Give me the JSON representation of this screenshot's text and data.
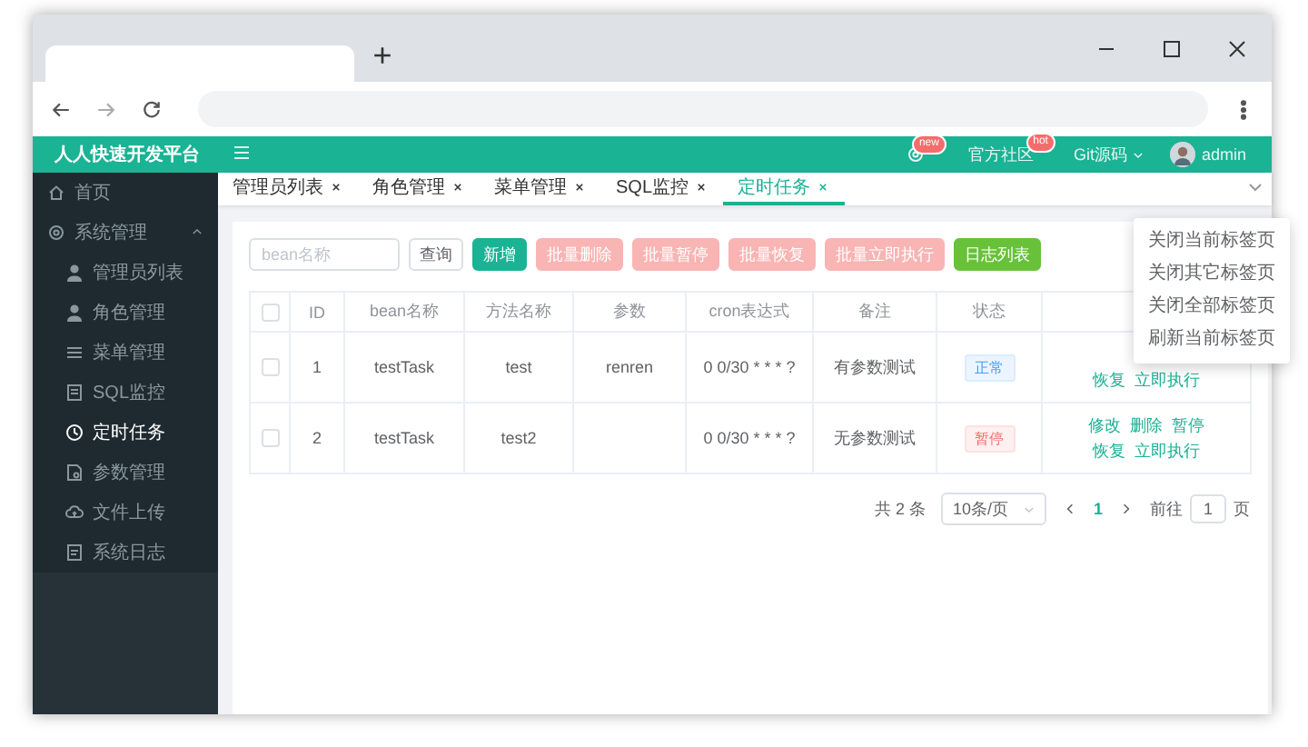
{
  "app": {
    "title": "人人快速开发平台"
  },
  "header": {
    "links": [
      {
        "kind": "icon",
        "badge": "new"
      },
      {
        "kind": "text",
        "label": "官方社区",
        "badge": "hot"
      },
      {
        "kind": "dropdown",
        "label": "Git源码"
      },
      {
        "kind": "user",
        "label": "admin"
      }
    ]
  },
  "sidebar": {
    "items": [
      {
        "label": "首页",
        "selected": false
      },
      {
        "label": "系统管理",
        "selected": false,
        "expanded": true,
        "children": [
          {
            "label": "管理员列表",
            "selected": false
          },
          {
            "label": "角色管理",
            "selected": false
          },
          {
            "label": "菜单管理",
            "selected": false
          },
          {
            "label": "SQL监控",
            "selected": false
          },
          {
            "label": "定时任务",
            "selected": true
          },
          {
            "label": "参数管理",
            "selected": false
          },
          {
            "label": "文件上传",
            "selected": false
          },
          {
            "label": "系统日志",
            "selected": false
          }
        ]
      }
    ]
  },
  "tabs": [
    {
      "label": "管理员列表",
      "selected": false
    },
    {
      "label": "角色管理",
      "selected": false
    },
    {
      "label": "菜单管理",
      "selected": false
    },
    {
      "label": "SQL监控",
      "selected": false
    },
    {
      "label": "定时任务",
      "selected": true
    }
  ],
  "tab_menu": {
    "items": [
      "关闭当前标签页",
      "关闭其它标签页",
      "关闭全部标签页",
      "刷新当前标签页"
    ]
  },
  "toolbar": {
    "search": {
      "placeholder": "bean名称"
    },
    "buttons": [
      {
        "label": "查询",
        "kind": "default",
        "disabled": false
      },
      {
        "label": "新增",
        "kind": "primary",
        "disabled": false
      },
      {
        "label": "批量删除",
        "kind": "danger",
        "disabled": true
      },
      {
        "label": "批量暂停",
        "kind": "danger",
        "disabled": true
      },
      {
        "label": "批量恢复",
        "kind": "danger",
        "disabled": true
      },
      {
        "label": "批量立即执行",
        "kind": "danger",
        "disabled": true
      },
      {
        "label": "日志列表",
        "kind": "success",
        "disabled": false
      }
    ]
  },
  "table": {
    "all_selected": false,
    "columns": [
      "ID",
      "bean名称",
      "方法名称",
      "参数",
      "cron表达式",
      "备注",
      "状态"
    ],
    "rows": [
      {
        "selected": false,
        "id": "1",
        "bean": "testTask",
        "method": "test",
        "params": "renren",
        "cron": "0 0/30 * * * ?",
        "remark": "有参数测试",
        "status": {
          "label": "正常",
          "kind": "normal"
        },
        "actions_bottom": [
          "恢复",
          "立即执行"
        ]
      },
      {
        "selected": false,
        "id": "2",
        "bean": "testTask",
        "method": "test2",
        "cron": "0 0/30 * * * ?",
        "remark": "无参数测试",
        "status": {
          "label": "暂停",
          "kind": "paused"
        },
        "actions_top": [
          "修改",
          "删除",
          "暂停"
        ],
        "actions_bottom": [
          "恢复",
          "立即执行"
        ]
      }
    ]
  },
  "pagination": {
    "total": "共 2 条",
    "page_size": "10条/页",
    "pages": [
      {
        "label": "1",
        "selected": true
      }
    ],
    "goto_label": "前往",
    "goto_value": "1",
    "goto_unit": "页"
  }
}
